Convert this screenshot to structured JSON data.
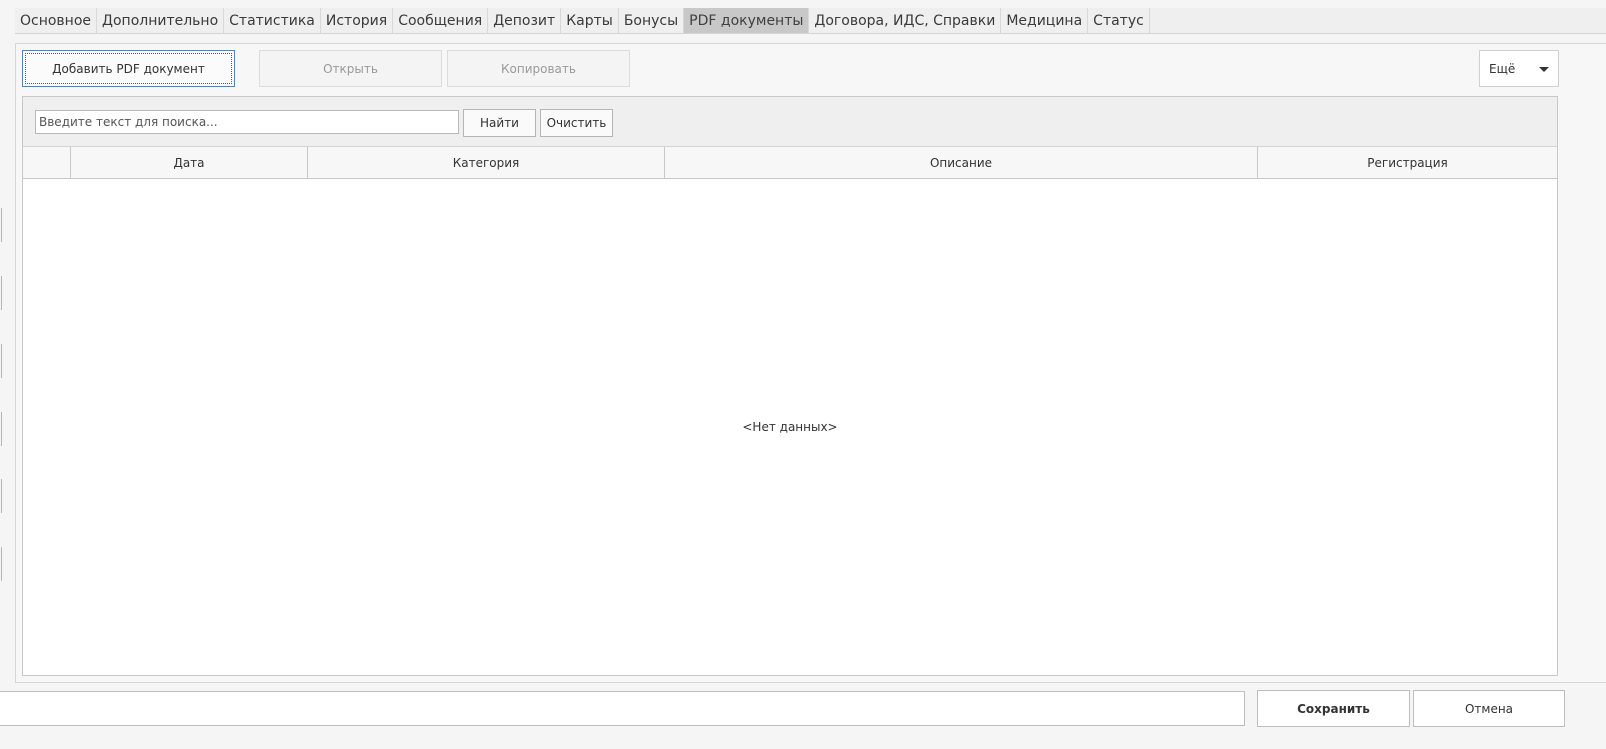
{
  "tabs": [
    {
      "label": "Основное"
    },
    {
      "label": "Дополнительно"
    },
    {
      "label": "Статистика"
    },
    {
      "label": "История"
    },
    {
      "label": "Сообщения"
    },
    {
      "label": "Депозит"
    },
    {
      "label": "Карты"
    },
    {
      "label": "Бонусы"
    },
    {
      "label": "PDF документы",
      "active": true
    },
    {
      "label": "Договора, ИДС, Справки"
    },
    {
      "label": "Медицина"
    },
    {
      "label": "Статус"
    }
  ],
  "toolbar": {
    "add_label": "Добавить PDF документ",
    "open_label": "Открыть",
    "copy_label": "Копировать",
    "more_label": "Ещё"
  },
  "search": {
    "placeholder": "Введите текст для поиска...",
    "find_label": "Найти",
    "clear_label": "Очистить"
  },
  "table": {
    "columns": [
      "",
      "Дата",
      "Категория",
      "Описание",
      "Регистрация"
    ],
    "empty_text": "<Нет данных>"
  },
  "footer": {
    "save_label": "Сохранить",
    "cancel_label": "Отмена"
  }
}
